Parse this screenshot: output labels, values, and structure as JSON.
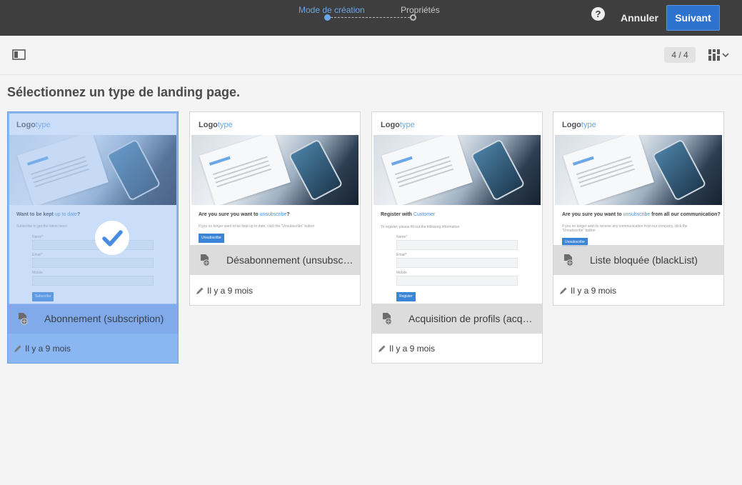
{
  "wizard": {
    "steps": [
      "Mode de création",
      "Propriétés"
    ],
    "help_icon": "help-icon",
    "help_label": "?",
    "cancel_label": "Annuler",
    "next_label": "Suivant"
  },
  "toolbar": {
    "counter": "4 / 4",
    "sidebar_icon": "sidebar-toggle-icon",
    "view_icon": "grid-view-icon"
  },
  "heading": "Sélectionnez un type de landing page.",
  "colors": {
    "accent": "#2d73cd",
    "selected": "#8ab6f2",
    "topbar": "#3e3e3e"
  },
  "cards": [
    {
      "title": "Abonnement (subscription)",
      "modified": "Il y a 9 mois",
      "selected": true,
      "thumb": {
        "logo_main": "Logo",
        "logo_accent": "type",
        "heading_pre": "Want to be kept ",
        "heading_link": "up to date",
        "heading_post": "?",
        "sub": "Subscribe to get the latest news",
        "fields": [
          "Name*",
          "Email*",
          "Mobile"
        ],
        "button": "Subscribe"
      }
    },
    {
      "title": "Désabonnement (unsubscription)",
      "modified": "Il y a 9 mois",
      "selected": false,
      "thumb": {
        "logo_main": "Logo",
        "logo_accent": "type",
        "heading_pre": "Are you sure you want to ",
        "heading_link": "unsubscribe",
        "heading_post": "?",
        "sub": "If you no longer want to be kept up to date, click the \"Unsubscribe\" button",
        "button": "Unsubscribe"
      }
    },
    {
      "title": "Acquisition de profils (acquisition)",
      "modified": "Il y a 9 mois",
      "selected": false,
      "thumb": {
        "logo_main": "Logo",
        "logo_accent": "type",
        "heading_pre": "Register with ",
        "heading_link": "Customer",
        "heading_post": "",
        "sub": "To register, please fill out the following information",
        "fields": [
          "Name*",
          "Email*",
          "Mobile"
        ],
        "button": "Register"
      }
    },
    {
      "title": "Liste bloquée (blackList)",
      "modified": "Il y a 9 mois",
      "selected": false,
      "thumb": {
        "logo_main": "Logo",
        "logo_accent": "type",
        "heading_pre": "Are you sure you want to ",
        "heading_link": "unsubscribe",
        "heading_post": " from all our communication?",
        "sub": "If you no longer wish to receive any communication from our company, click the \"Unsubscribe\" button",
        "button": "Unsubscribe"
      }
    }
  ]
}
